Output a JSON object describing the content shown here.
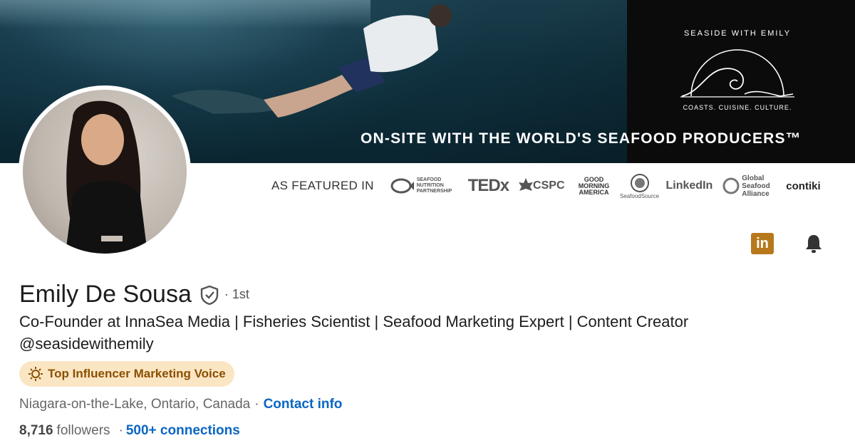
{
  "banner": {
    "brand_name": "SEASIDE WITH EMILY",
    "brand_tagline": "COASTS. CUISINE. CULTURE.",
    "tagline": "ON-SITE WITH THE WORLD'S SEAFOOD PRODUCERS™"
  },
  "featured": {
    "label": "AS FEATURED IN",
    "logos": [
      "SEAFOOD NUTRITION PARTNERSHIP",
      "TEDx",
      "CSPC",
      "GOOD MORNING AMERICA",
      "SeafoodSource",
      "LinkedIn",
      "Global Seafood Alliance",
      "contiki"
    ]
  },
  "actions": {
    "linkedin_icon": "linkedin-icon",
    "bell_icon": "bell-icon"
  },
  "profile": {
    "name": "Emily De Sousa",
    "degree": "· 1st",
    "headline": "Co-Founder at InnaSea Media | Fisheries Scientist | Seafood Marketing Expert | Content Creator @seasidewithemily",
    "badge": "Top Influencer Marketing Voice",
    "location": "Niagara-on-the-Lake, Ontario, Canada",
    "location_sep": "·",
    "contact_info": "Contact info",
    "followers_count": "8,716",
    "followers_label": "followers",
    "stats_sep": "·",
    "connections": "500+ connections"
  },
  "colors": {
    "link": "#0a66c2",
    "badge_bg": "#fbe6c4",
    "badge_text": "#8a4f00",
    "linkedin_icon": "#b7781c"
  }
}
